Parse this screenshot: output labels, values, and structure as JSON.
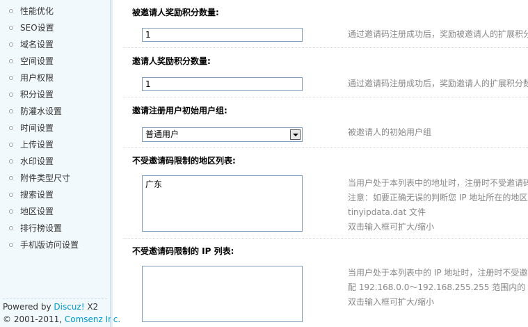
{
  "sidebar": {
    "items": [
      "性能优化",
      "SEO设置",
      "域名设置",
      "空间设置",
      "用户权限",
      "积分设置",
      "防灌水设置",
      "时间设置",
      "上传设置",
      "水印设置",
      "附件类型尺寸",
      "搜索设置",
      "地区设置",
      "排行榜设置",
      "手机版访问设置"
    ]
  },
  "footer": {
    "powered_prefix": "Powered by ",
    "powered_link": "Discuz!",
    "powered_suffix": " X2",
    "copyright_prefix": "© 2001-2011, ",
    "copyright_link": "Comsenz Inc."
  },
  "settings": {
    "invitee_reward": {
      "label": "被邀请人奖励积分数量:",
      "value": "1",
      "hint": "通过邀请码注册成功后，奖励被邀请人的扩展积分"
    },
    "inviter_reward": {
      "label": "邀请人奖励积分数量:",
      "value": "1",
      "hint": "通过邀请码注册成功后，奖励邀请人的扩展积分数"
    },
    "initial_group": {
      "label": "邀请注册用户初始用户组:",
      "selected": "普通用户",
      "hint": "被邀请人的初始用户组"
    },
    "area_whitelist": {
      "label": "不受邀请码限制的地区列表:",
      "value": "广东",
      "hint_lines": [
        "当用户处于本列表中的地址时，注册时不受邀请码",
        "注意：如要正确无误的判断您 IP 地址所在的地区",
        "tinyipdata.dat 文件",
        "双击输入框可扩大/缩小"
      ]
    },
    "ip_whitelist": {
      "label": "不受邀请码限制的 IP 列表:",
      "value": "",
      "hint_lines": [
        "当用户处于本列表中的 IP 地址时，注册时不受邀",
        "配 192.168.0.0～192.168.255.255 范围内的",
        "双击输入框可扩大/缩小"
      ]
    }
  }
}
